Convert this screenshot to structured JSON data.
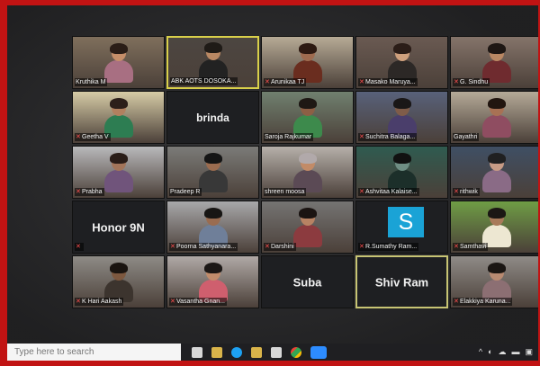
{
  "participants": [
    {
      "name": "Kruthika M",
      "type": "video",
      "muted": false,
      "bg": "#7f6f5c",
      "shirt": "#a86f82",
      "skin": "#c58e69",
      "hair": "#2a1d17",
      "mute_icon": "mute-icon"
    },
    {
      "name": "ABK AOTS DOSOKA...",
      "type": "video",
      "muted": false,
      "bg": "#4c4641",
      "shirt": "#222222",
      "skin": "#b98863",
      "hair": "#1f1b17",
      "active": true
    },
    {
      "name": "Arunikaa TJ",
      "type": "video",
      "muted": true,
      "bg": "#b7ab96",
      "shirt": "#6a2d1f",
      "skin": "#9e6b4f",
      "hair": "#2d1a12"
    },
    {
      "name": "Masako Maruya...",
      "type": "video",
      "muted": true,
      "bg": "#6a5a52",
      "shirt": "#2c2826",
      "skin": "#cfa07d",
      "hair": "#2b1d18"
    },
    {
      "name": "G. Sindhu",
      "type": "video",
      "muted": true,
      "bg": "#85746a",
      "shirt": "#6f2b2f",
      "skin": "#b98763",
      "hair": "#1e1714"
    },
    {
      "name": "Geetha V",
      "type": "video",
      "muted": true,
      "bg": "#d6cba6",
      "shirt": "#2d7d52",
      "skin": "#b1805f",
      "hair": "#2c1f1a"
    },
    {
      "name": "brinda",
      "type": "name",
      "muted": false
    },
    {
      "name": "Saroja Rajkumar",
      "type": "video",
      "muted": false,
      "bg": "#70806f",
      "shirt": "#3d8a4c",
      "skin": "#8d5f45",
      "hair": "#1e1814"
    },
    {
      "name": "Suchitra Balaga...",
      "type": "video",
      "muted": true,
      "bg": "#58617a",
      "shirt": "#4a3e6b",
      "skin": "#7f5c49",
      "hair": "#1a1717"
    },
    {
      "name": "Gayathri",
      "type": "video",
      "muted": false,
      "bg": "#b5aa98",
      "shirt": "#8f4d61",
      "skin": "#a87154",
      "hair": "#21150f"
    },
    {
      "name": "Prabha",
      "type": "video",
      "muted": true,
      "bg": "#b9b9bb",
      "shirt": "#70547b",
      "skin": "#a3755a",
      "hair": "#2a1d18"
    },
    {
      "name": "Pradeep R",
      "type": "video",
      "muted": false,
      "bg": "#7b7b78",
      "shirt": "#383838",
      "skin": "#9b6c4f",
      "hair": "#151515"
    },
    {
      "name": "shreen moosa",
      "type": "video",
      "muted": false,
      "bg": "#b6b0aa",
      "shirt": "#5b4a55",
      "skin": "#c28b67",
      "hair": "#b1a9aa"
    },
    {
      "name": "Ashvitaa Kalaise...",
      "type": "video",
      "muted": true,
      "bg": "#2f5b50",
      "shirt": "#1c2f2a",
      "skin": "#6f8e84",
      "hair": "#111"
    },
    {
      "name": "rithwik",
      "type": "video",
      "muted": true,
      "bg": "#3f4f64",
      "shirt": "#8a6b86",
      "skin": "#c79b85",
      "hair": "#202021"
    },
    {
      "name": "Honor 9N",
      "type": "name",
      "muted": true
    },
    {
      "name": "Poorna Sathyanara...",
      "type": "video",
      "muted": true,
      "bg": "#a8a8aa",
      "shirt": "#6f7f99",
      "skin": "#9a6c50",
      "hair": "#181614"
    },
    {
      "name": "Darshini",
      "type": "video",
      "muted": true,
      "bg": "#757473",
      "shirt": "#8c3b3f",
      "skin": "#b78263",
      "hair": "#1b1412"
    },
    {
      "name": "R.Sumathy Ram...",
      "type": "avatar",
      "muted": true,
      "avatar": "S"
    },
    {
      "name": "Samthavi",
      "type": "video",
      "muted": true,
      "bg": "#6f9d45",
      "shirt": "#ede7d2",
      "skin": "#a87a5a",
      "hair": "#1b1714"
    },
    {
      "name": "K Hari Aakash",
      "type": "video",
      "muted": true,
      "bg": "#8e8b86",
      "shirt": "#3c342e",
      "skin": "#7d583f",
      "hair": "#1a1410"
    },
    {
      "name": "Vasantha Gnan...",
      "type": "video",
      "muted": true,
      "bg": "#b0a9a6",
      "shirt": "#cf5f6e",
      "skin": "#c18c6b",
      "hair": "#1c1816"
    },
    {
      "name": "Suba",
      "type": "name",
      "muted": false
    },
    {
      "name": "Shiv Ram",
      "type": "name",
      "muted": false,
      "shiv": true
    },
    {
      "name": "Elakkiya Karuna...",
      "type": "video",
      "muted": true,
      "bg": "#8f8b87",
      "shirt": "#8c6f73",
      "skin": "#b88a71",
      "hair": "#1b1613"
    }
  ],
  "taskbar": {
    "search_placeholder": "Type here to search"
  }
}
